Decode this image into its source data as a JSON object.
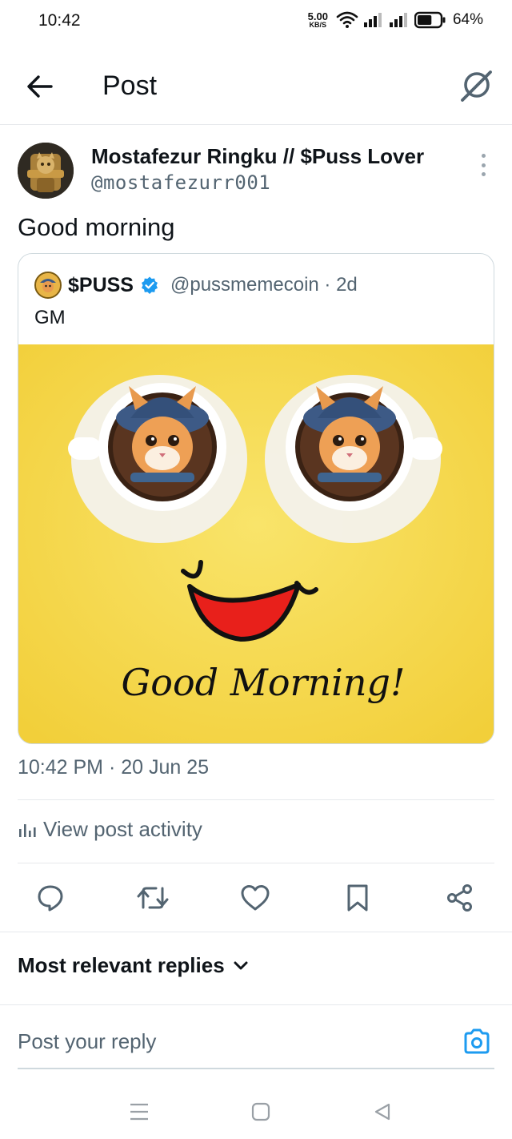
{
  "status_bar": {
    "time": "10:42",
    "net_speed_value": "5.00",
    "net_speed_unit": "KB/S",
    "battery_percent": "64%",
    "battery_level": 0.64
  },
  "header": {
    "title": "Post",
    "back_icon": "arrow-left-icon",
    "grok_icon": "grok-icon"
  },
  "post": {
    "author_name": "Mostafezur Ringku // $Puss Lover",
    "author_handle": "@mostafezurr001",
    "text": "Good morning",
    "timestamp": "10:42 PM · 20 Jun 25",
    "activity_label": "View post activity"
  },
  "quote": {
    "name": "$PUSS",
    "handle": "@pussmemecoin · 2d",
    "text": "GM",
    "image_caption": "Good Morning!"
  },
  "actions": [
    "reply-icon",
    "repost-icon",
    "like-icon",
    "bookmark-icon",
    "share-icon"
  ],
  "replies": {
    "sort_label": "Most relevant replies"
  },
  "reply_box": {
    "placeholder": "Post your reply"
  },
  "colors": {
    "text_primary": "#0f1419",
    "text_secondary": "#536471",
    "accent": "#1d9bf0",
    "image_background": "#f5d945"
  }
}
